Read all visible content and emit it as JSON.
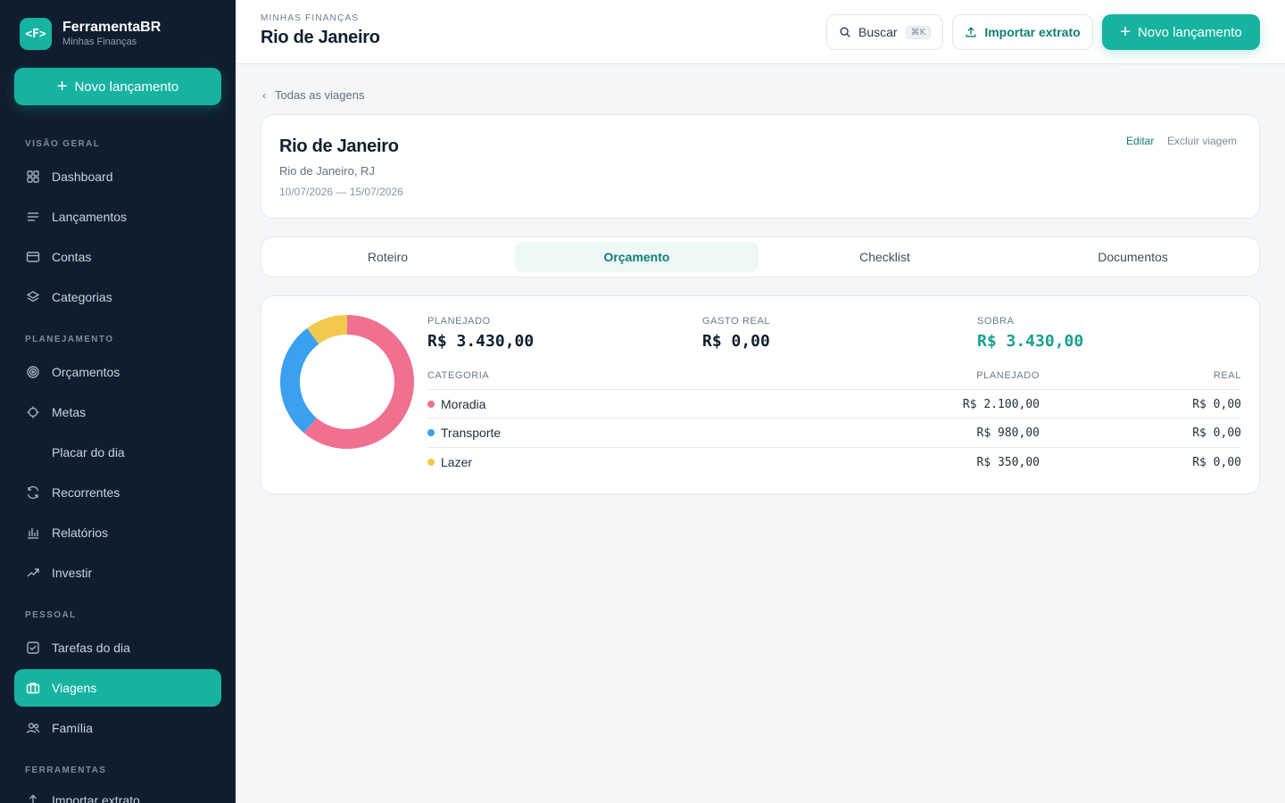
{
  "brand": {
    "logo": "<F>",
    "name": "FerramentaBR",
    "subtitle": "Minhas Finanças"
  },
  "sidebar": {
    "cta_label": "Novo lançamento",
    "sections": {
      "overview": "VISÃO GERAL",
      "planning": "PLANEJAMENTO",
      "personal": "PESSOAL",
      "tools": "FERRAMENTAS"
    },
    "items": [
      {
        "label": "Dashboard",
        "icon": "grid-icon"
      },
      {
        "label": "Lançamentos",
        "icon": "list-icon"
      },
      {
        "label": "Contas",
        "icon": "card-icon"
      },
      {
        "label": "Categorias",
        "icon": "layers-icon"
      },
      {
        "label": "Orçamentos",
        "icon": "target-icon"
      },
      {
        "label": "Metas",
        "icon": "crosshair-icon"
      },
      {
        "label": "Placar do dia",
        "icon": ""
      },
      {
        "label": "Recorrentes",
        "icon": "refresh-icon"
      },
      {
        "label": "Relatórios",
        "icon": "bar-chart-icon"
      },
      {
        "label": "Investir",
        "icon": "trending-up-icon"
      },
      {
        "label": "Tarefas do dia",
        "icon": "checkbox-icon"
      },
      {
        "label": "Viagens",
        "icon": "suitcase-icon",
        "active": true
      },
      {
        "label": "Família",
        "icon": "users-icon"
      },
      {
        "label": "Importar extrato",
        "icon": "upload-icon"
      }
    ]
  },
  "header": {
    "eyebrow": "MINHAS FINANÇAS",
    "title": "Rio de Janeiro",
    "search_label": "Buscar",
    "search_shortcut": "⌘K",
    "import_label": "Importar extrato",
    "new_label": "Novo lançamento"
  },
  "back_link": "Todas as viagens",
  "trip": {
    "title": "Rio de Janeiro",
    "location": "Rio de Janeiro, RJ",
    "dates": "10/07/2026 — 15/07/2026",
    "edit_label": "Editar",
    "delete_label": "Excluir viagem"
  },
  "tabs": [
    {
      "label": "Roteiro"
    },
    {
      "label": "Orçamento",
      "active": true
    },
    {
      "label": "Checklist"
    },
    {
      "label": "Documentos"
    }
  ],
  "budget": {
    "planned_label": "PLANEJADO",
    "planned_value": "R$ 3.430,00",
    "spent_label": "GASTO REAL",
    "spent_value": "R$ 0,00",
    "remaining_label": "SOBRA",
    "remaining_value": "R$ 3.430,00",
    "table_headers": {
      "category": "CATEGORIA",
      "planned": "PLANEJADO",
      "real": "REAL"
    },
    "rows": [
      {
        "category": "Moradia",
        "planned": "R$ 2.100,00",
        "real": "R$ 0,00",
        "color": "#f0708f"
      },
      {
        "category": "Transporte",
        "planned": "R$ 980,00",
        "real": "R$ 0,00",
        "color": "#3aa0f0"
      },
      {
        "category": "Lazer",
        "planned": "R$ 350,00",
        "real": "R$ 0,00",
        "color": "#f2c94c"
      }
    ]
  },
  "chart_data": {
    "type": "pie",
    "categories": [
      "Moradia",
      "Transporte",
      "Lazer"
    ],
    "values": [
      2100,
      980,
      350
    ],
    "colors": [
      "#f0708f",
      "#3aa0f0",
      "#f2c94c"
    ]
  },
  "colors": {
    "accent": "#16b3a0",
    "sidebar_bg": "#0f1e2e"
  }
}
